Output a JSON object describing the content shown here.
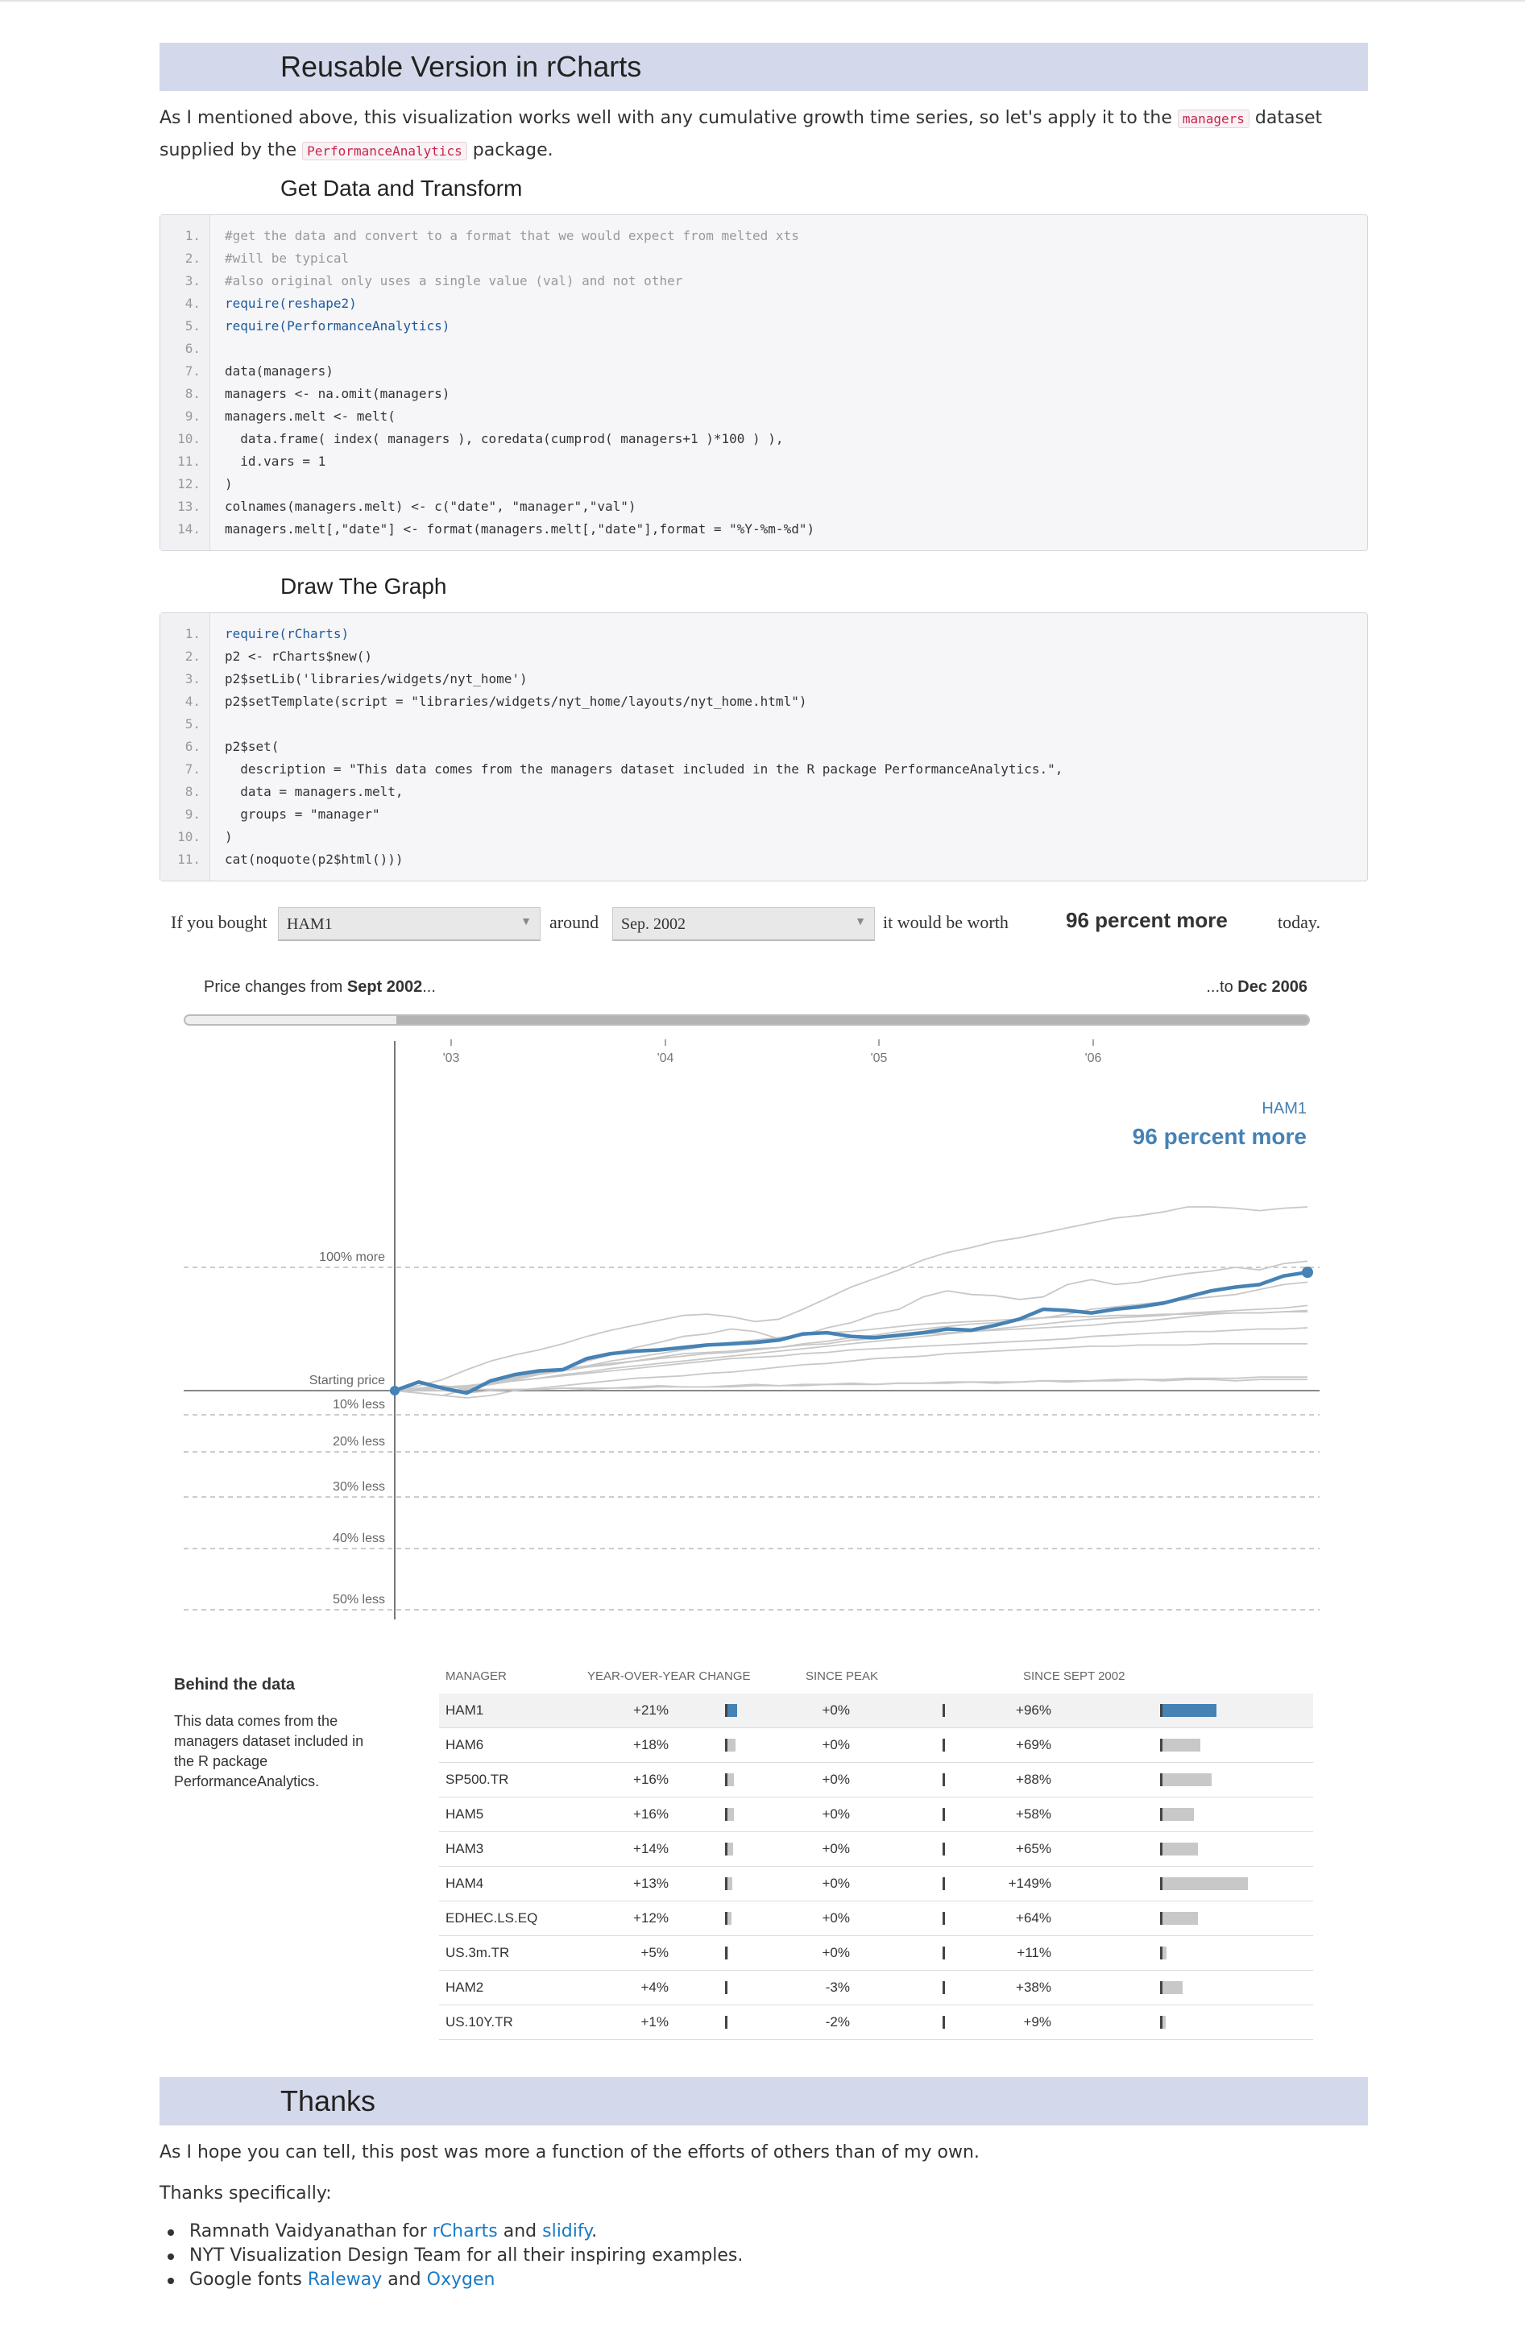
{
  "section1": {
    "title": "Reusable Version in rCharts"
  },
  "intro": {
    "part1": "As I mentioned above, this visualization works well with any cumulative growth time series, so let's apply it to the ",
    "code1": "managers",
    "part2": " dataset supplied by the ",
    "code2": "PerformanceAnalytics",
    "part3": " package."
  },
  "subhead1": "Get Data and Transform",
  "code1": [
    {
      "n": "1.",
      "t": "#get the data and convert to a format that we would expect from melted xts",
      "c": "cm"
    },
    {
      "n": "2.",
      "t": "#will be typical",
      "c": "cm"
    },
    {
      "n": "3.",
      "t": "#also original only uses a single value (val) and not other",
      "c": "cm"
    },
    {
      "n": "4.",
      "t": "require(reshape2)",
      "c": "kw"
    },
    {
      "n": "5.",
      "t": "require(PerformanceAnalytics)",
      "c": "kw"
    },
    {
      "n": "6.",
      "t": "",
      "c": ""
    },
    {
      "n": "7.",
      "t": "data(managers)",
      "c": ""
    },
    {
      "n": "8.",
      "t": "managers <- na.omit(managers)",
      "c": ""
    },
    {
      "n": "9.",
      "t": "managers.melt <- melt(",
      "c": ""
    },
    {
      "n": "10.",
      "t": "  data.frame( index( managers ), coredata(cumprod( managers+1 )*100 ) ),",
      "c": ""
    },
    {
      "n": "11.",
      "t": "  id.vars = 1",
      "c": ""
    },
    {
      "n": "12.",
      "t": ")",
      "c": ""
    },
    {
      "n": "13.",
      "t": "colnames(managers.melt) <- c(\"date\", \"manager\",\"val\")",
      "c": ""
    },
    {
      "n": "14.",
      "t": "managers.melt[,\"date\"] <- format(managers.melt[,\"date\"],format = \"%Y-%m-%d\")",
      "c": ""
    }
  ],
  "subhead2": "Draw The Graph",
  "code2": [
    {
      "n": "1.",
      "t": "require(rCharts)",
      "c": "kw"
    },
    {
      "n": "2.",
      "t": "p2 <- rCharts$new()",
      "c": ""
    },
    {
      "n": "3.",
      "t": "p2$setLib('libraries/widgets/nyt_home')",
      "c": ""
    },
    {
      "n": "4.",
      "t": "p2$setTemplate(script = \"libraries/widgets/nyt_home/layouts/nyt_home.html\")",
      "c": ""
    },
    {
      "n": "5.",
      "t": "",
      "c": ""
    },
    {
      "n": "6.",
      "t": "p2$set(",
      "c": ""
    },
    {
      "n": "7.",
      "t": "  description = \"This data comes from the managers dataset included in the R package PerformanceAnalytics.\",",
      "c": ""
    },
    {
      "n": "8.",
      "t": "  data = managers.melt,",
      "c": ""
    },
    {
      "n": "9.",
      "t": "  groups = \"manager\"",
      "c": ""
    },
    {
      "n": "10.",
      "t": ")",
      "c": ""
    },
    {
      "n": "11.",
      "t": "cat(noquote(p2$html()))",
      "c": ""
    }
  ],
  "widget": {
    "if_you_bought": "If you bought",
    "manager_selected": "HAM1",
    "around": "around",
    "date_selected": "Sep. 2002",
    "would_be_worth": "it would be worth",
    "result": "96 percent more",
    "today": "today.",
    "price_from_prefix": "Price changes from ",
    "price_from_date": "Sept 2002",
    "price_from_suffix": "...",
    "price_to_prefix": "...to ",
    "price_to_date": "Dec 2006"
  },
  "chart_data": {
    "type": "line",
    "x_ticks": [
      "'03",
      "'04",
      "'05",
      "'06"
    ],
    "y_labels": [
      "100% more",
      "Starting price",
      "10% less",
      "20% less",
      "30% less",
      "40% less",
      "50% less"
    ],
    "highlight": {
      "name": "HAM1",
      "label": "96 percent more"
    },
    "ylim": [
      -50,
      115
    ],
    "series": [
      {
        "name": "HAM1",
        "highlight": true,
        "values": [
          0,
          7,
          2,
          -1,
          8,
          13,
          16,
          17,
          26,
          30,
          32,
          33,
          35,
          37,
          38,
          39,
          41,
          46,
          47,
          44,
          43,
          45,
          47,
          50,
          49,
          53,
          58,
          66,
          65,
          63,
          66,
          68,
          71,
          76,
          81,
          84,
          86,
          93,
          96
        ]
      },
      {
        "values": [
          0,
          1,
          3,
          2,
          5,
          9,
          15,
          18,
          24,
          29,
          35,
          39,
          44,
          46,
          50,
          48,
          42,
          45,
          51,
          55,
          62,
          66,
          76,
          81,
          78,
          77,
          74,
          76,
          86,
          90,
          86,
          88,
          92,
          95,
          97,
          100,
          98,
          103,
          105
        ]
      },
      {
        "values": [
          0,
          4,
          9,
          17,
          24,
          29,
          33,
          38,
          44,
          49,
          53,
          57,
          61,
          62,
          60,
          56,
          58,
          66,
          75,
          84,
          91,
          98,
          106,
          112,
          116,
          121,
          124,
          128,
          132,
          136,
          140,
          142,
          145,
          149,
          149,
          148,
          146,
          148,
          149
        ]
      },
      {
        "values": [
          0,
          2,
          4,
          1,
          6,
          10,
          14,
          18,
          20,
          22,
          24,
          27,
          30,
          31,
          32,
          34,
          35,
          38,
          40,
          43,
          45,
          48,
          50,
          52,
          54,
          55,
          57,
          59,
          62,
          66,
          68,
          70,
          72,
          74,
          76,
          78,
          82,
          86,
          88
        ]
      },
      {
        "values": [
          0,
          1,
          2,
          3,
          7,
          11,
          15,
          16,
          19,
          21,
          24,
          26,
          28,
          30,
          31,
          33,
          35,
          37,
          38,
          41,
          42,
          44,
          46,
          47,
          48,
          50,
          52,
          54,
          56,
          58,
          59,
          60,
          61,
          63,
          64,
          65,
          66,
          67,
          69
        ]
      },
      {
        "values": [
          0,
          -1,
          -2,
          1,
          5,
          8,
          10,
          13,
          15,
          18,
          20,
          22,
          24,
          26,
          28,
          30,
          32,
          34,
          36,
          38,
          40,
          42,
          44,
          46,
          48,
          49,
          50,
          51,
          52,
          53,
          55,
          56,
          58,
          60,
          62,
          63,
          63,
          64,
          65
        ]
      },
      {
        "values": [
          0,
          1,
          2,
          4,
          6,
          9,
          13,
          16,
          20,
          24,
          27,
          30,
          33,
          36,
          39,
          41,
          43,
          45,
          47,
          48,
          50,
          52,
          54,
          55,
          56,
          57,
          58,
          59,
          60,
          60,
          61,
          61,
          62,
          62,
          63,
          63,
          63,
          64,
          64
        ]
      },
      {
        "values": [
          0,
          2,
          3,
          4,
          6,
          8,
          10,
          12,
          14,
          16,
          18,
          20,
          22,
          24,
          26,
          27,
          28,
          30,
          31,
          33,
          34,
          35,
          36,
          37,
          38,
          39,
          40,
          41,
          42,
          44,
          45,
          46,
          47,
          48,
          48,
          49,
          50,
          50,
          51
        ]
      },
      {
        "values": [
          0,
          -1,
          -2,
          -3,
          -2,
          0,
          2,
          4,
          6,
          8,
          10,
          11,
          12,
          14,
          15,
          17,
          19,
          21,
          22,
          24,
          26,
          27,
          28,
          30,
          31,
          32,
          33,
          34,
          35,
          36,
          36,
          37,
          37,
          37,
          38,
          38,
          38,
          38,
          38
        ]
      },
      {
        "values": [
          0,
          0,
          0,
          1,
          1,
          1,
          1,
          2,
          2,
          2,
          2,
          3,
          3,
          3,
          3,
          4,
          4,
          4,
          5,
          5,
          5,
          6,
          6,
          6,
          7,
          7,
          7,
          8,
          8,
          8,
          9,
          9,
          9,
          10,
          10,
          10,
          11,
          11,
          11
        ]
      },
      {
        "values": [
          0,
          1,
          0,
          -1,
          0,
          1,
          1,
          2,
          1,
          2,
          3,
          4,
          3,
          3,
          4,
          5,
          4,
          5,
          5,
          6,
          5,
          6,
          6,
          7,
          7,
          6,
          7,
          8,
          7,
          8,
          8,
          9,
          8,
          9,
          9,
          8,
          9,
          9,
          9
        ]
      }
    ]
  },
  "behind": {
    "title": "Behind the data",
    "text": "This data comes from the managers dataset included in the R package PerformanceAnalytics."
  },
  "table": {
    "headers": [
      "MANAGER",
      "YEAR-OVER-YEAR CHANGE",
      "SINCE PEAK",
      "SINCE SEPT 2002"
    ],
    "rows": [
      {
        "name": "HAM1",
        "yoy": "+21%",
        "peak": "+0%",
        "since": "+96%",
        "yoy_v": 21,
        "since_v": 96,
        "hl": true
      },
      {
        "name": "HAM6",
        "yoy": "+18%",
        "peak": "+0%",
        "since": "+69%",
        "yoy_v": 18,
        "since_v": 69
      },
      {
        "name": "SP500.TR",
        "yoy": "+16%",
        "peak": "+0%",
        "since": "+88%",
        "yoy_v": 16,
        "since_v": 88
      },
      {
        "name": "HAM5",
        "yoy": "+16%",
        "peak": "+0%",
        "since": "+58%",
        "yoy_v": 16,
        "since_v": 58
      },
      {
        "name": "HAM3",
        "yoy": "+14%",
        "peak": "+0%",
        "since": "+65%",
        "yoy_v": 14,
        "since_v": 65
      },
      {
        "name": "HAM4",
        "yoy": "+13%",
        "peak": "+0%",
        "since": "+149%",
        "yoy_v": 13,
        "since_v": 149
      },
      {
        "name": "EDHEC.LS.EQ",
        "yoy": "+12%",
        "peak": "+0%",
        "since": "+64%",
        "yoy_v": 12,
        "since_v": 64
      },
      {
        "name": "US.3m.TR",
        "yoy": "+5%",
        "peak": "+0%",
        "since": "+11%",
        "yoy_v": 5,
        "since_v": 11
      },
      {
        "name": "HAM2",
        "yoy": "+4%",
        "peak": "-3%",
        "since": "+38%",
        "yoy_v": 4,
        "since_v": 38
      },
      {
        "name": "US.10Y.TR",
        "yoy": "+1%",
        "peak": "-2%",
        "since": "+9%",
        "yoy_v": 1,
        "since_v": 9
      }
    ]
  },
  "section2": {
    "title": "Thanks"
  },
  "thanks": {
    "line1": "As I hope you can tell, this post was more a function of the efforts of others than of my own.",
    "line2": "Thanks specifically:",
    "item1_pre": "Ramnath Vaidyanathan for ",
    "item1_link1": "rCharts",
    "item1_mid": " and ",
    "item1_link2": "slidify",
    "item1_post": ".",
    "item2": "NYT Visualization Design Team for all their inspiring examples.",
    "item3_pre": "Google fonts ",
    "item3_link1": "Raleway",
    "item3_mid": " and ",
    "item3_link2": "Oxygen"
  },
  "colors": {
    "accent": "#4682b4",
    "section_bg": "#d3d9ea",
    "link": "#1a7ac4",
    "grey_line": "#c8c8c8"
  }
}
